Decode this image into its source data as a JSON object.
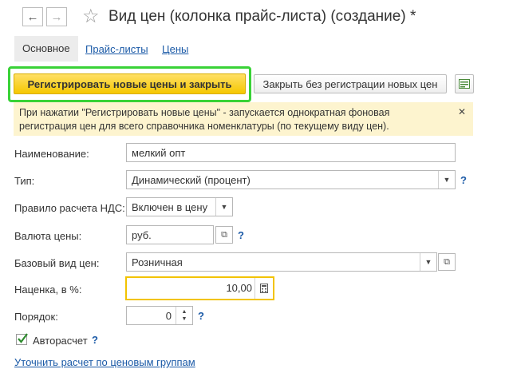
{
  "window": {
    "title": "Вид цен (колонка прайс-листа) (создание) *",
    "back_icon": "←",
    "forward_icon": "→",
    "star_icon": "☆"
  },
  "tabs": [
    {
      "label": "Основное"
    },
    {
      "label": "Прайс-листы"
    },
    {
      "label": "Цены"
    }
  ],
  "toolbar": {
    "register_label": "Регистрировать новые цены и закрыть",
    "close_label": "Закрыть без регистрации новых цен"
  },
  "info": {
    "text_line1": "При нажатии \"Регистрировать новые цены\" - запускается однократная фоновая",
    "text_line2": "регистрация цен для всего справочника номенклатуры (по текущему виду цен).",
    "close_icon": "✕"
  },
  "form": {
    "name_label": "Наименование:",
    "name_value": "мелкий опт",
    "type_label": "Тип:",
    "type_value": "Динамический (процент)",
    "vat_label": "Правило расчета НДС:",
    "vat_value": "Включен в цену",
    "currency_label": "Валюта цены:",
    "currency_value": "руб.",
    "base_label": "Базовый вид цен:",
    "base_value": "Розничная",
    "markup_label": "Наценка, в %:",
    "markup_value": "10,00",
    "order_label": "Порядок:",
    "order_value": "0",
    "autocalc_label": "Авторасчет",
    "question": "?",
    "refine_link": "Уточнить расчет по ценовым группам"
  },
  "colors": {
    "accent_yellow": "#f5c800",
    "highlight_green": "#39d237",
    "link_blue": "#1b5aa7",
    "info_bg": "#fdf4cf"
  }
}
